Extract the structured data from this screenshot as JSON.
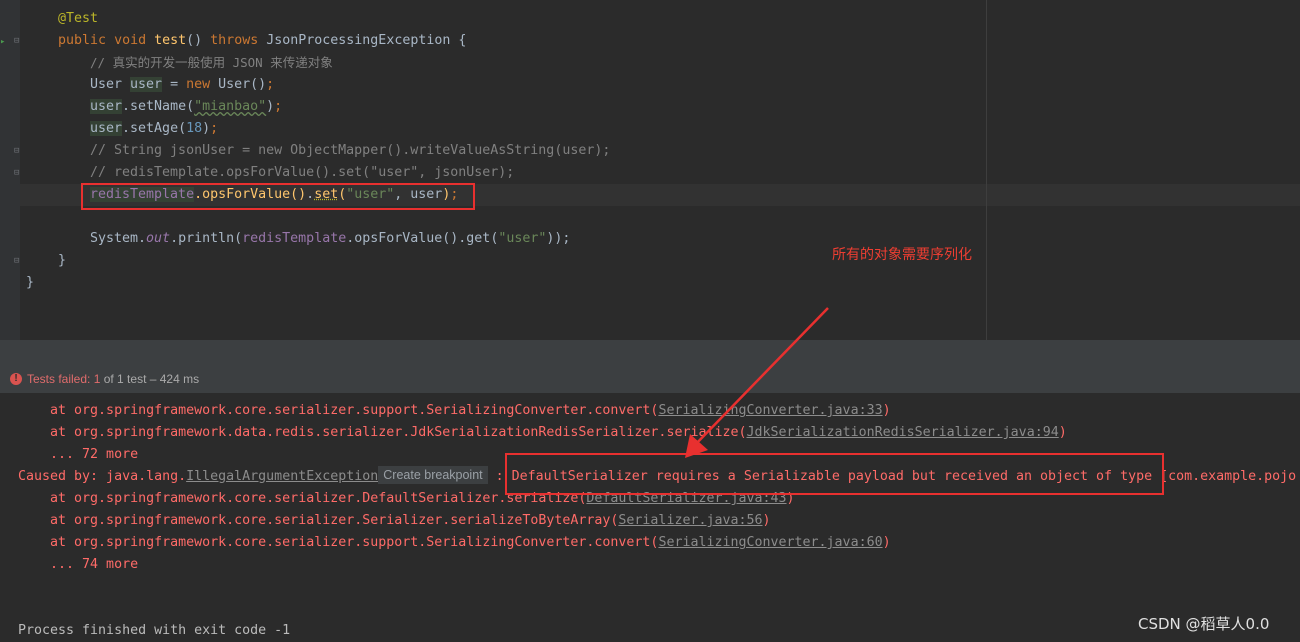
{
  "editor": {
    "annotation": "@Test",
    "sig_public": "public",
    "sig_void": "void",
    "sig_name": "test",
    "sig_parens": "()",
    "sig_throws": "throws",
    "sig_exception": "JsonProcessingException",
    "sig_brace": "{",
    "comment1": "// 真实的开发一般使用 JSON 来传递对象",
    "l3_type": "User ",
    "l3_var": "user",
    "l3_eq": " = ",
    "l3_new": "new",
    "l3_ctor": " User()",
    "l3_semi": ";",
    "l4_var": "user",
    "l4_call": ".setName(",
    "l4_str": "\"mianbao\"",
    "l4_end": ")",
    "l4_semi": ";",
    "l5_var": "user",
    "l5_call": ".setAge(",
    "l5_num": "18",
    "l5_end": ")",
    "l5_semi": ";",
    "comment2": "// String jsonUser = new ObjectMapper().writeValueAsString(user);",
    "comment3": "// redisTemplate.opsForValue().set(\"user\", jsonUser);",
    "l8_field": "redisTemplate",
    "l8_call1": ".opsForValue",
    "l8_paren1": "()",
    "l8_dot": ".",
    "l8_set": "set",
    "l8_open": "(",
    "l8_str": "\"user\"",
    "l8_mid": ", user",
    "l8_close": ")",
    "l8_semi": ";",
    "l10_pre": "System.",
    "l10_out": "out",
    "l10_print": ".println(",
    "l10_field": "redisTemplate",
    "l10_ops": ".opsForValue().get(",
    "l10_str": "\"user\"",
    "l10_end": "));",
    "close_inner": "}",
    "close_outer": "}"
  },
  "annotation_label": "所有的对象需要序列化",
  "test_status": {
    "icon": "error-icon",
    "failed_label": "Tests failed: 1",
    "rest": " of 1 test – 424 ms"
  },
  "console": {
    "l1_pre": "    at org.springframework.core.serializer.support.SerializingConverter.convert(",
    "l1_link": "SerializingConverter.java:33",
    "l1_post": ")",
    "l2_pre": "    at org.springframework.data.redis.serializer.JdkSerializationRedisSerializer.serialize(",
    "l2_link": "JdkSerializationRedisSerializer.java:94",
    "l2_post": ")",
    "l3": "    ... 72 more",
    "l4_pre": "Caused by: java.lang.",
    "l4_link": "IllegalArgumentException",
    "l4_tooltip": "Create breakpoint",
    "l4_msg": " : DefaultSerializer requires a Serializable payload but received an object of type [com.example.pojo",
    "l5_pre": "    at org.springframework.core.serializer.DefaultSerializer.serialize(",
    "l5_link": "DefaultSerializer.java:43",
    "l5_post": ")",
    "l6_pre": "    at org.springframework.core.serializer.Serializer.serializeToByteArray(",
    "l6_link": "Serializer.java:56",
    "l6_post": ")",
    "l7_pre": "    at org.springframework.core.serializer.support.SerializingConverter.convert(",
    "l7_link": "SerializingConverter.java:60",
    "l7_post": ")",
    "l8": "    ... 74 more",
    "exit": "Process finished with exit code -1"
  },
  "watermark": "CSDN @稻草人0.0",
  "colors": {
    "background": "#2b2b2b",
    "keyword": "#cc7832",
    "string": "#6a8759",
    "error_text": "#ff6b68",
    "highlight_box": "#e8302f"
  }
}
